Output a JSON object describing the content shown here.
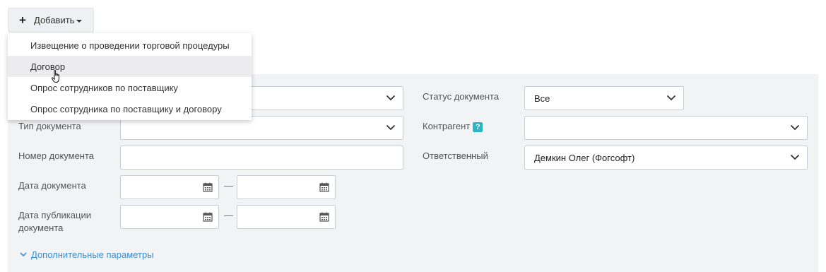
{
  "toolbar": {
    "add_label": "Добавить",
    "add_icon": "plus-icon"
  },
  "dropdown": {
    "items": [
      {
        "label": "Извещение о проведении торговой процедуры"
      },
      {
        "label": "Договор"
      },
      {
        "label": "Опрос сотрудников по поставщику"
      },
      {
        "label": "Опрос сотрудника по поставщику и договору"
      }
    ],
    "hovered_index": 1
  },
  "filters": {
    "doc_type_label": "Тип документа",
    "doc_type_value": "",
    "doc_number_label": "Номер документа",
    "doc_number_value": "",
    "doc_date_label": "Дата документа",
    "doc_pub_date_label_line1": "Дата публикации",
    "doc_pub_date_label_line2": "документа",
    "range_separator": "—",
    "status_label": "Статус документа",
    "status_value": "Все",
    "counterparty_label": "Контрагент",
    "counterparty_help": "?",
    "counterparty_value": "",
    "responsible_label": "Ответственный",
    "responsible_value": "Демкин Олег (Фогсофт)"
  },
  "more_params_label": "Дополнительные параметры",
  "colors": {
    "accent_link": "#3c8ed0",
    "help_badge": "#2bb5c4",
    "panel_bg": "#f2f3f5"
  }
}
